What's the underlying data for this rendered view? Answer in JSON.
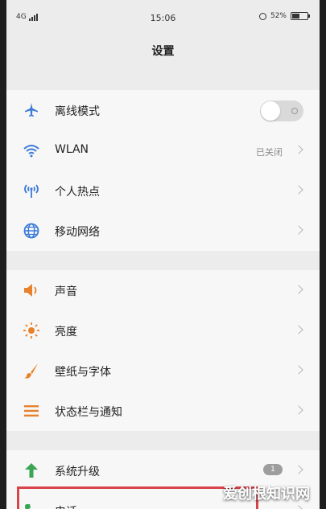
{
  "status_bar": {
    "network": "4G",
    "time": "15:06",
    "battery": "52%",
    "battery_level": 0.52
  },
  "header": {
    "title": "设置"
  },
  "groups": [
    {
      "items": [
        {
          "label": "离线模式",
          "icon": "airplane-icon",
          "control": "toggle",
          "toggle_on": false
        },
        {
          "label": "WLAN",
          "icon": "wifi-icon",
          "value": "已关闭"
        },
        {
          "label": "个人热点",
          "icon": "hotspot-icon"
        },
        {
          "label": "移动网络",
          "icon": "globe-icon"
        }
      ]
    },
    {
      "items": [
        {
          "label": "声音",
          "icon": "speaker-icon"
        },
        {
          "label": "亮度",
          "icon": "brightness-icon"
        },
        {
          "label": "壁纸与字体",
          "icon": "brush-icon"
        },
        {
          "label": "状态栏与通知",
          "icon": "list-icon"
        }
      ]
    },
    {
      "items": [
        {
          "label": "系统升级",
          "icon": "upgrade-arrow-icon",
          "badge": "1"
        },
        {
          "label": "电话",
          "icon": "phone-icon"
        }
      ]
    }
  ],
  "colors": {
    "accent_blue": "#3a7ad8",
    "orange": "#e8812b",
    "green": "#3aa655",
    "highlight_red": "#d9434a"
  },
  "watermark": "爱创根知识网"
}
